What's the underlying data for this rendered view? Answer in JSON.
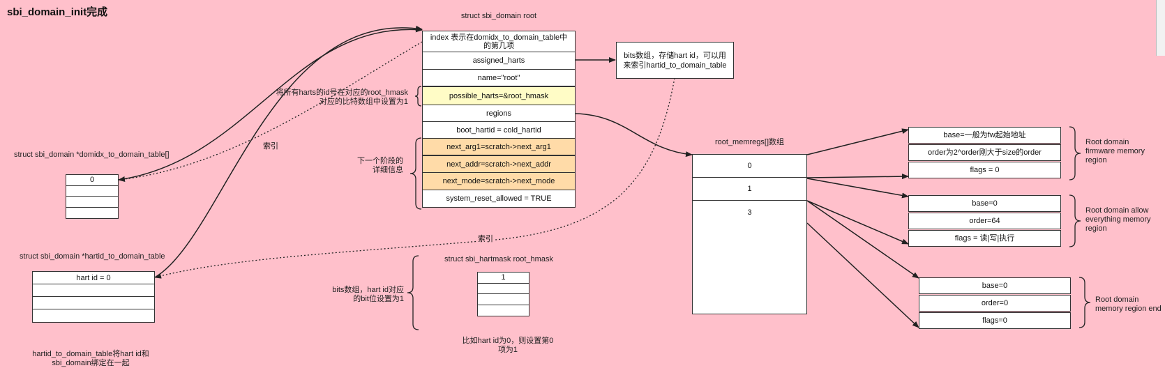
{
  "page_title": "sbi_domain_init完成",
  "root": {
    "title": "struct sbi_domain root",
    "fields": [
      {
        "text": "index 表示在domidx_to_domain_table中的第几项",
        "style": "white"
      },
      {
        "text": "assigned_harts",
        "style": "white"
      },
      {
        "text": "name=\"root\"",
        "style": "white"
      },
      {
        "text": "possible_harts=&root_hmask",
        "style": "yellow"
      },
      {
        "text": "regions",
        "style": "white"
      },
      {
        "text": "boot_hartid = cold_hartid",
        "style": "white"
      },
      {
        "text": "next_arg1=scratch->next_arg1",
        "style": "orange"
      },
      {
        "text": "next_addr=scratch->next_addr",
        "style": "orange"
      },
      {
        "text": "next_mode=scratch->next_mode",
        "style": "orange"
      },
      {
        "text": "system_reset_allowed = TRUE",
        "style": "white"
      }
    ]
  },
  "bits_note": "bits数组，存储hart id，可以用来索引hartid_to_domain_table",
  "possible_harts_note_line1": "将所有harts的id号在对应的root_hmask",
  "possible_harts_note_line2": "对应的比特数组中设置为1",
  "next_stage_note_line1": "下一个阶段的",
  "next_stage_note_line2": "详细信息",
  "index_label_1": "索引",
  "index_label_2": "索引",
  "domidx_table": {
    "title": "struct sbi_domain *domidx_to_domain_table[]",
    "rows": [
      "0",
      "",
      "",
      ""
    ]
  },
  "hartid_table": {
    "title": "struct sbi_domain *hartid_to_domain_table",
    "rows": [
      "hart id = 0",
      "",
      "",
      ""
    ],
    "note_line1": "hartid_to_domain_table将hart id和",
    "note_line2": "sbi_domain绑定在一起"
  },
  "hartmask": {
    "title": "struct sbi_hartmask root_hmask",
    "rows": [
      "1",
      "",
      "",
      ""
    ],
    "left_note_line1": "bits数组，hart id对应",
    "left_note_line2": "的bit位设置为1",
    "bottom_note_line1": "比如hart id为0，则设置第0",
    "bottom_note_line2": "项为1"
  },
  "memregs": {
    "title": "root_memregs[]数组",
    "rows": [
      "0",
      "1",
      "3"
    ]
  },
  "regions": [
    {
      "fields": [
        "base=一般为fw起始地址",
        "order为2^order刚大于size的order",
        "flags = 0"
      ],
      "note": [
        "Root domain",
        "firmware memory",
        "region"
      ]
    },
    {
      "fields": [
        "base=0",
        "order=64",
        "flags = 读|写|执行"
      ],
      "note": [
        "Root domain allow",
        "everything memory",
        "region"
      ]
    },
    {
      "fields": [
        "base=0",
        "order=0",
        "flags=0"
      ],
      "note": [
        "Root domain",
        "memory region end"
      ]
    }
  ]
}
